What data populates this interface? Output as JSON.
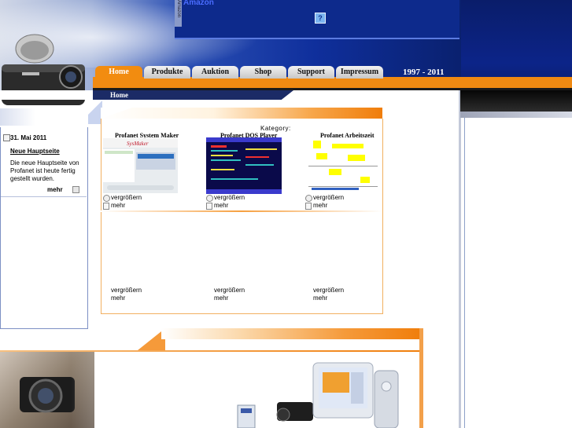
{
  "header": {
    "amazon_label": "Amazon",
    "amazon_side": "Amazon",
    "help_glyph": "?",
    "years": "1997 - 2011"
  },
  "nav": {
    "tabs": [
      "Home",
      "Produkte",
      "Auktion",
      "Shop",
      "Support",
      "Impressum"
    ],
    "active": "Home"
  },
  "breadcrumb": "Home",
  "news": {
    "date": "31. Mai 2011",
    "title": "Neue Hauptseite",
    "body": "Die neue Hauptseite von Profanet ist heute fertig gestellt wurden.",
    "more": "mehr"
  },
  "content": {
    "category_label": "Kategory:",
    "products": [
      {
        "title": "Profanet System Maker",
        "link1": "vergrößern",
        "link2": "mehr"
      },
      {
        "title": "Profanet DOS Player",
        "link1": "vergrößern",
        "link2": "mehr"
      },
      {
        "title": "Profanet Arbeitszeit",
        "link1": "vergrößern",
        "link2": "mehr"
      }
    ],
    "row2": [
      {
        "link1": "vergrößern",
        "link2": "mehr"
      },
      {
        "link1": "vergrößern",
        "link2": "mehr"
      },
      {
        "link1": "vergrößern",
        "link2": "mehr"
      }
    ]
  },
  "colors": {
    "accent": "#f08a12",
    "header_blue": "#0f2f9c",
    "border_blue": "#7d90c4"
  }
}
